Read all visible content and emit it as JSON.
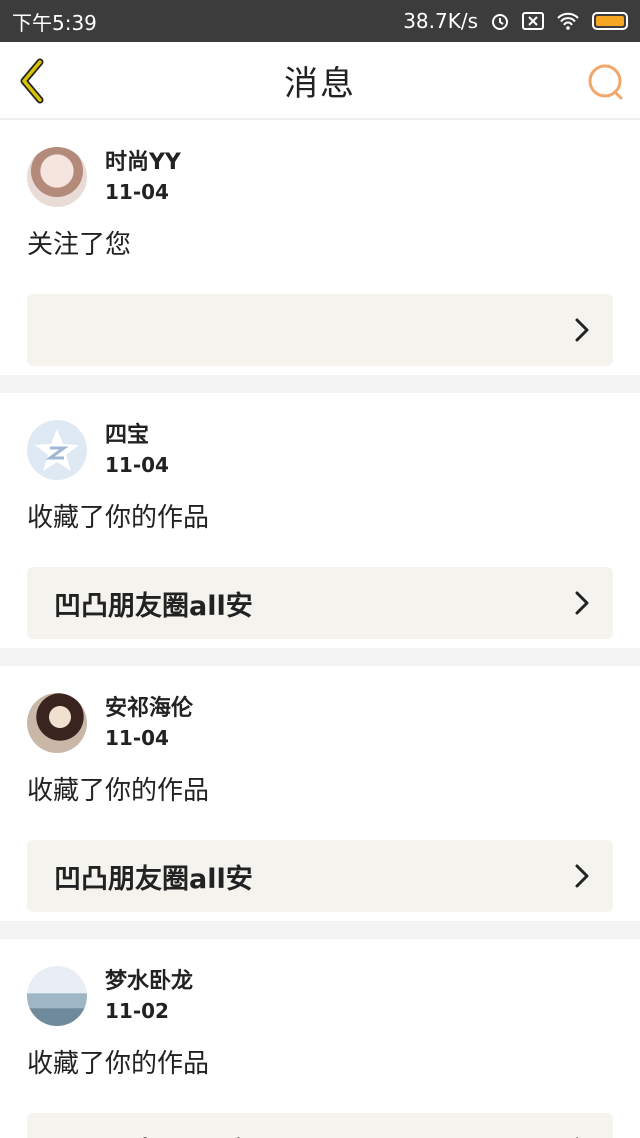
{
  "status_bar": {
    "time": "下午5:39",
    "network_speed": "38.7K/s",
    "icons": [
      "alarm-icon",
      "sim-icon",
      "wifi-icon",
      "battery-icon"
    ],
    "battery_color": "#f5a623"
  },
  "nav": {
    "title": "消息",
    "back_icon": "chevron-left-icon",
    "search_icon": "search-icon",
    "accent_color": "#c8b800",
    "search_color": "#f2a66a"
  },
  "messages": [
    {
      "user": "时尚YY",
      "date": "11-04",
      "action": "关注了您",
      "work": ""
    },
    {
      "user": "四宝",
      "date": "11-04",
      "action": "收藏了你的作品",
      "work": "凹凸朋友圈all安"
    },
    {
      "user": "安祁海伦",
      "date": "11-04",
      "action": "收藏了你的作品",
      "work": "凹凸朋友圈all安"
    },
    {
      "user": "梦水卧龙",
      "date": "11-02",
      "action": "收藏了你的作品",
      "work": "凹凸朋友圈all安"
    }
  ]
}
